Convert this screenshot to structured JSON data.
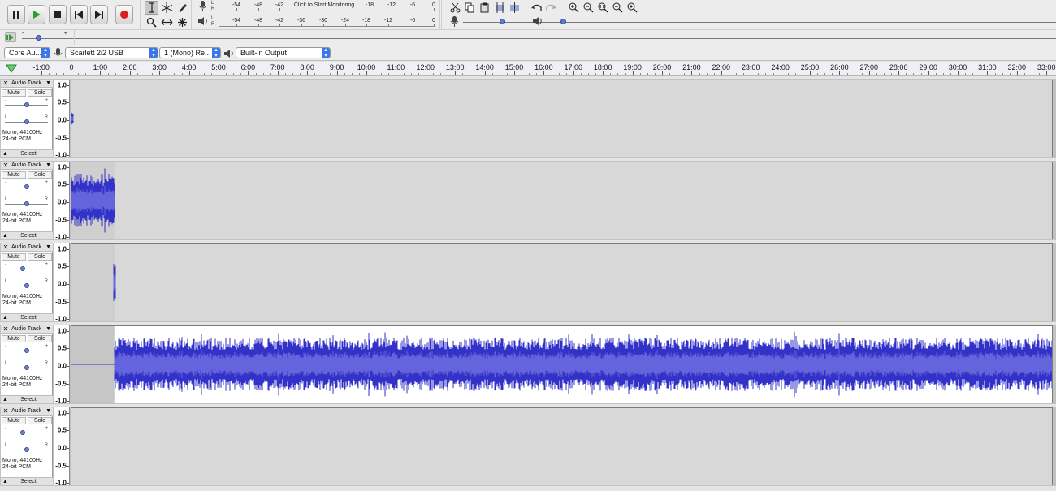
{
  "transport": {
    "buttons": [
      {
        "id": "pause",
        "icon": "pause-icon"
      },
      {
        "id": "play",
        "icon": "play-icon"
      },
      {
        "id": "stop",
        "icon": "stop-icon"
      },
      {
        "id": "skip-start",
        "icon": "skip-start-icon"
      },
      {
        "id": "skip-end",
        "icon": "skip-end-icon"
      },
      {
        "id": "record",
        "icon": "record-icon"
      }
    ]
  },
  "tools": {
    "selection": "selection-tool-icon",
    "envelope": "envelope-tool-icon",
    "draw": "draw-tool-icon",
    "zoom": "zoom-tool-icon",
    "timeshift": "timeshift-tool-icon",
    "multi": "multi-tool-icon"
  },
  "meters": {
    "record_ticks": [
      "-54",
      "-48",
      "-42",
      "-18",
      "-12",
      "-6",
      "0"
    ],
    "monitor_prompt": "Click to Start Monitoring",
    "playback_ticks": [
      "-54",
      "-48",
      "-42",
      "-36",
      "-30",
      "-24",
      "-18",
      "-12",
      "-6",
      "0"
    ],
    "lr_top": "L",
    "lr_bottom": "R"
  },
  "mixer": {
    "record_volume": 0.6,
    "playback_volume": 0.25
  },
  "play_at_speed": {
    "minus": "-",
    "plus": "+",
    "value": 0.33
  },
  "devices": {
    "host": "Core Au...",
    "recording_device": "Scarlett 2i2 USB",
    "channels": "1 (Mono) Re...",
    "playback_device": "Built-in Output"
  },
  "ruler": {
    "labels": [
      "-1:00",
      "0",
      "1:00",
      "2:00",
      "3:00",
      "4:00",
      "5:00",
      "6:00",
      "7:00",
      "8:00",
      "9:00",
      "10:00",
      "11:00",
      "12:00",
      "13:00",
      "14:00",
      "15:00",
      "16:00",
      "17:00",
      "18:00",
      "19:00",
      "20:00",
      "21:00",
      "22:00",
      "23:00",
      "24:00",
      "25:00",
      "26:00",
      "27:00",
      "28:00",
      "29:00",
      "30:00",
      "31:00",
      "32:00",
      "33:00"
    ]
  },
  "tracks": [
    {
      "name": "Audio Track",
      "mute": "Mute",
      "solo": "Solo",
      "gain": 0.5,
      "pan": 0.5,
      "format_line1": "Mono, 44100Hz",
      "format_line2": "24-bit PCM",
      "select": "Select",
      "selected": false,
      "clip_start": 0,
      "clip_end": 0.05,
      "amplitude": 0.2
    },
    {
      "name": "Audio Track",
      "mute": "Mute",
      "solo": "Solo",
      "gain": 0.5,
      "pan": 0.5,
      "format_line1": "Mono, 44100Hz",
      "format_line2": "24-bit PCM",
      "select": "Select",
      "selected": false,
      "clip_start": 0,
      "clip_end": 1.45,
      "amplitude": 0.7
    },
    {
      "name": "Audio Track",
      "mute": "Mute",
      "solo": "Solo",
      "gain": 0.4,
      "pan": 0.5,
      "format_line1": "Mono, 44100Hz",
      "format_line2": "24-bit PCM",
      "select": "Select",
      "selected": false,
      "clip_start": 1.42,
      "clip_end": 1.48,
      "amplitude": 0.5
    },
    {
      "name": "Audio Track",
      "mute": "Mute",
      "solo": "Solo",
      "gain": 0.5,
      "pan": 0.5,
      "format_line1": "Mono, 44100Hz",
      "format_line2": "24-bit PCM",
      "select": "Select",
      "selected": true,
      "clip_start": 1.45,
      "clip_end": 33.3,
      "amplitude": 0.7
    },
    {
      "name": "Audio Track",
      "mute": "Mute",
      "solo": "Solo",
      "gain": 0.4,
      "pan": 0.5,
      "format_line1": "Mono, 44100Hz",
      "format_line2": "24-bit PCM",
      "select": "Select",
      "selected": false,
      "clip_start": 0,
      "clip_end": 0,
      "amplitude": 0
    }
  ],
  "vertical_scale": [
    "1.0",
    "0.5",
    "0.0",
    "-0.5",
    "-1.0"
  ],
  "colors": {
    "waveform": "#3232c8",
    "waveform_rms": "#6464dc",
    "track_bg": "#d8d8d8",
    "selected_bg": "#ffffff"
  }
}
